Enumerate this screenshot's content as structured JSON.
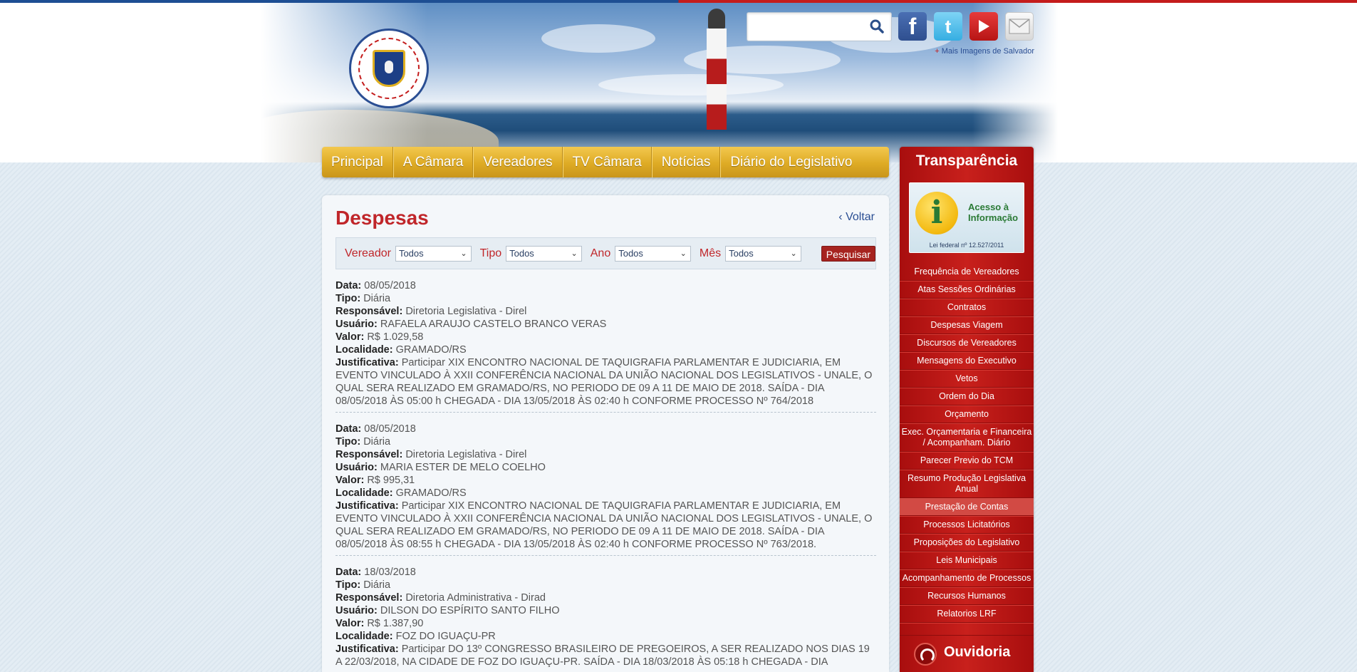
{
  "header": {
    "logo_alt": "CÂMARA MUNICIPAL DE SALVADOR - O Poder do Cidadão",
    "search": {
      "placeholder": "",
      "value": ""
    },
    "social": [
      {
        "name": "facebook-icon",
        "label": "f"
      },
      {
        "name": "twitter-icon",
        "label": "t"
      },
      {
        "name": "youtube-icon",
        "label": ""
      },
      {
        "name": "mail-icon",
        "label": ""
      }
    ],
    "more_images_plus": "+",
    "more_images": "Mais Imagens de Salvador"
  },
  "nav": {
    "items": [
      "Principal",
      "A Câmara",
      "Vereadores",
      "TV Câmara",
      "Notícias",
      "Diário do Legislativo"
    ]
  },
  "main": {
    "title": "Despesas",
    "back": "Voltar",
    "filters": {
      "vereador_label": "Vereador",
      "vereador_value": "Todos",
      "tipo_label": "Tipo",
      "tipo_value": "Todos",
      "ano_label": "Ano",
      "ano_value": "Todos",
      "mes_label": "Mês",
      "mes_value": "Todos",
      "submit": "Pesquisar"
    },
    "keys": {
      "data": "Data:",
      "tipo": "Tipo:",
      "responsavel": "Responsável:",
      "usuario": "Usuário:",
      "valor": "Valor:",
      "localidade": "Localidade:",
      "justificativa": "Justificativa:"
    },
    "records": [
      {
        "data": "08/05/2018",
        "tipo": "Diária",
        "responsavel": "Diretoria Legislativa - Direl",
        "usuario": "RAFAELA ARAUJO CASTELO BRANCO VERAS",
        "valor": "R$ 1.029,58",
        "localidade": "GRAMADO/RS",
        "justificativa": "Participar XIX ENCONTRO NACIONAL DE TAQUIGRAFIA PARLAMENTAR E JUDICIARIA, EM EVENTO VINCULADO À XXII CONFERÊNCIA NACIONAL DA UNIÃO NACIONAL DOS LEGISLATIVOS - UNALE, O QUAL SERA REALIZADO EM GRAMADO/RS, NO PERIODO DE 09 A 11 DE MAIO DE 2018. SAÍDA - DIA 08/05/2018 ÀS 05:00 h CHEGADA - DIA 13/05/2018 ÀS 02:40 h CONFORME PROCESSO Nº 764/2018"
      },
      {
        "data": "08/05/2018",
        "tipo": "Diária",
        "responsavel": "Diretoria Legislativa - Direl",
        "usuario": "MARIA ESTER DE MELO COELHO",
        "valor": "R$ 995,31",
        "localidade": "GRAMADO/RS",
        "justificativa": "Participar XIX ENCONTRO NACIONAL DE TAQUIGRAFIA PARLAMENTAR E JUDICIARIA, EM EVENTO VINCULADO À XXII CONFERÊNCIA NACIONAL DA UNIÃO NACIONAL DOS LEGISLATIVOS - UNALE, O QUAL SERA REALIZADO EM GRAMADO/RS, NO PERIODO DE 09 A 11 DE MAIO DE 2018. SAÍDA - DIA 08/05/2018 ÀS 08:55 h CHEGADA - DIA 13/05/2018 ÀS 02:40 h CONFORME PROCESSO Nº 763/2018."
      },
      {
        "data": "18/03/2018",
        "tipo": "Diária",
        "responsavel": "Diretoria Administrativa - Dirad",
        "usuario": "DILSON DO ESPÍRITO SANTO FILHO",
        "valor": "R$ 1.387,90",
        "localidade": "FOZ DO IGUAÇU-PR",
        "justificativa": "Participar DO 13º CONGRESSO BRASILEIRO DE PREGOEIROS, A SER REALIZADO NOS DIAS 19 A 22/03/2018, NA CIDADE DE FOZ DO IGUAÇU-PR. SAÍDA - DIA 18/03/2018 ÀS 05:18 h CHEGADA - DIA"
      }
    ]
  },
  "sidebar": {
    "title": "Transparência",
    "acesso": {
      "title": "Acesso à Informação",
      "law": "Lei federal nº 12.527/2011"
    },
    "items": [
      "Frequência de Vereadores",
      "Atas Sessões Ordinárias",
      "Contratos",
      "Despesas Viagem",
      "Discursos de Vereadores",
      "Mensagens do Executivo",
      "Vetos",
      "Ordem do Dia",
      "Orçamento",
      "Exec. Orçamentaria e Financeira / Acompanham. Diário",
      "Parecer Previo do TCM",
      "Resumo Produção Legislativa Anual",
      "Prestação de Contas",
      "Processos Licitatórios",
      "Proposições do Legislativo",
      "Leis Municipais",
      "Acompanhamento de Processos",
      "Recursos Humanos",
      "Relatorios LRF"
    ],
    "active_item": "Prestação de Contas",
    "ouvidoria": "Ouvidoria"
  }
}
